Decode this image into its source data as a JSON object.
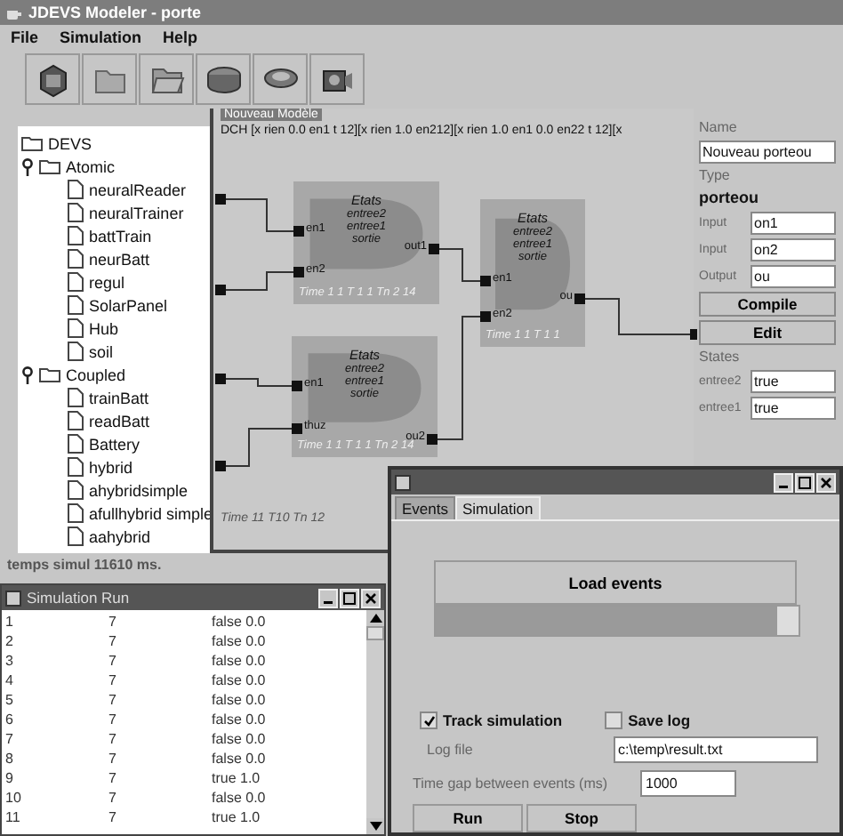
{
  "window": {
    "title": "JDEVS Modeler - porte"
  },
  "menu": [
    "File",
    "Simulation",
    "Help"
  ],
  "tree": {
    "label": "DEVS",
    "children": [
      {
        "label": "Atomic",
        "expanded": true,
        "children": [
          {
            "label": "neuralReader"
          },
          {
            "label": "neuralTrainer"
          },
          {
            "label": "battTrain"
          },
          {
            "label": "neurBatt"
          },
          {
            "label": "regul"
          },
          {
            "label": "SolarPanel"
          },
          {
            "label": "Hub"
          },
          {
            "label": "soil"
          }
        ]
      },
      {
        "label": "Coupled",
        "expanded": true,
        "children": [
          {
            "label": "trainBatt"
          },
          {
            "label": "readBatt"
          },
          {
            "label": "Battery"
          },
          {
            "label": "hybrid"
          },
          {
            "label": "ahybridsimple"
          },
          {
            "label": "afullhybrid simple"
          },
          {
            "label": "aahybrid"
          }
        ]
      }
    ]
  },
  "canvas": {
    "title": "Nouveau Modèle",
    "header": "DCH [x rien 0.0 en1 t 12][x rien 1.0 en212][x rien 1.0 en1 0.0 en22 t 12][x",
    "footer": "Time 11 T10 Tn 12",
    "nodes": [
      {
        "title": "Etats",
        "lines": [
          "entree2",
          "entree1",
          "sortie"
        ],
        "inputs": [
          "en1",
          "en2"
        ],
        "output": "out1",
        "footer": "Time 1 1 T 1 1 Tn 2 14"
      },
      {
        "title": "Etats",
        "lines": [
          "entree2",
          "entree1",
          "sortie"
        ],
        "inputs": [
          "en1",
          "thuz"
        ],
        "output": "ou2",
        "footer": "Time 1 1 T 1 1 Tn 2 14"
      },
      {
        "title": "Etats",
        "lines": [
          "entree2",
          "entree1",
          "sortie"
        ],
        "inputs": [
          "en1",
          "en2"
        ],
        "output": "ou",
        "footer": "Time 1 1 T 1 1"
      }
    ]
  },
  "properties": {
    "name_label": "Name",
    "name_value": "Nouveau porteou",
    "type_label": "Type",
    "type_value": "porteou",
    "ports": [
      {
        "label": "Input",
        "value": "on1"
      },
      {
        "label": "Input",
        "value": "on2"
      },
      {
        "label": "Output",
        "value": "ou"
      }
    ],
    "buttons": [
      "Compile",
      "Edit"
    ],
    "states_label": "States",
    "states": [
      {
        "label": "entree2",
        "value": "true"
      },
      {
        "label": "entree1",
        "value": "true"
      }
    ]
  },
  "status_bar": "temps simul 11610 ms.",
  "sim_run": {
    "title": "Simulation Run",
    "rows": [
      [
        "1",
        "7",
        "false 0.0"
      ],
      [
        "2",
        "7",
        "false 0.0"
      ],
      [
        "3",
        "7",
        "false 0.0"
      ],
      [
        "4",
        "7",
        "false 0.0"
      ],
      [
        "5",
        "7",
        "false 0.0"
      ],
      [
        "6",
        "7",
        "false 0.0"
      ],
      [
        "7",
        "7",
        "false 0.0"
      ],
      [
        "8",
        "7",
        "false 0.0"
      ],
      [
        "9",
        "7",
        "true 1.0"
      ],
      [
        "10",
        "7",
        "false 0.0"
      ],
      [
        "11",
        "7",
        "true 1.0"
      ]
    ]
  },
  "dialog": {
    "tabs": [
      {
        "label": "Events",
        "selected": false
      },
      {
        "label": "Simulation",
        "selected": true
      }
    ],
    "load_button": "Load events",
    "progress": {
      "level": 0.94
    },
    "options": [
      {
        "label": "Track simulation",
        "checked": true
      },
      {
        "label": "Save log",
        "checked": false
      }
    ],
    "log_file": {
      "label": "Log file",
      "value": "c:\\temp\\result.txt"
    },
    "time_gap": {
      "label": "Time gap between events (ms)",
      "value": "1000"
    },
    "buttons": [
      "Run",
      "Stop"
    ]
  }
}
